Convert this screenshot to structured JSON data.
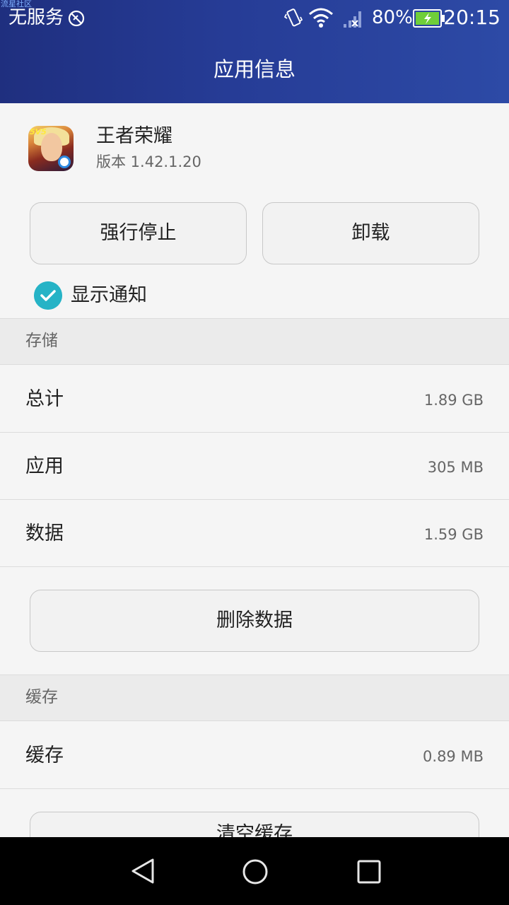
{
  "status_bar": {
    "watermark": "流星社区",
    "carrier": "无服务",
    "battery_percent": "80%",
    "time": "20:15",
    "icons": [
      "no-service-icon",
      "vibrate-icon",
      "wifi-icon",
      "signal-icon",
      "battery-charging-icon"
    ]
  },
  "title": "应用信息",
  "app": {
    "name": "王者荣耀",
    "version": "版本 1.42.1.20",
    "icon_badge": "5V5"
  },
  "buttons": {
    "force_stop": "强行停止",
    "uninstall": "卸载",
    "clear_data": "删除数据",
    "clear_cache": "清空缓存"
  },
  "notification": {
    "label": "显示通知",
    "checked": true
  },
  "storage": {
    "header": "存储",
    "rows": [
      {
        "label": "总计",
        "value": "1.89 GB"
      },
      {
        "label": "应用",
        "value": "305 MB"
      },
      {
        "label": "数据",
        "value": "1.59 GB"
      }
    ]
  },
  "cache": {
    "header": "缓存",
    "rows": [
      {
        "label": "缓存",
        "value": "0.89 MB"
      }
    ]
  },
  "colors": {
    "header_start": "#1f2f7f",
    "header_end": "#2d4aa6",
    "accent": "#26b3c6",
    "background": "#f5f5f5"
  },
  "nav": [
    "back-icon",
    "home-icon",
    "recent-apps-icon"
  ]
}
